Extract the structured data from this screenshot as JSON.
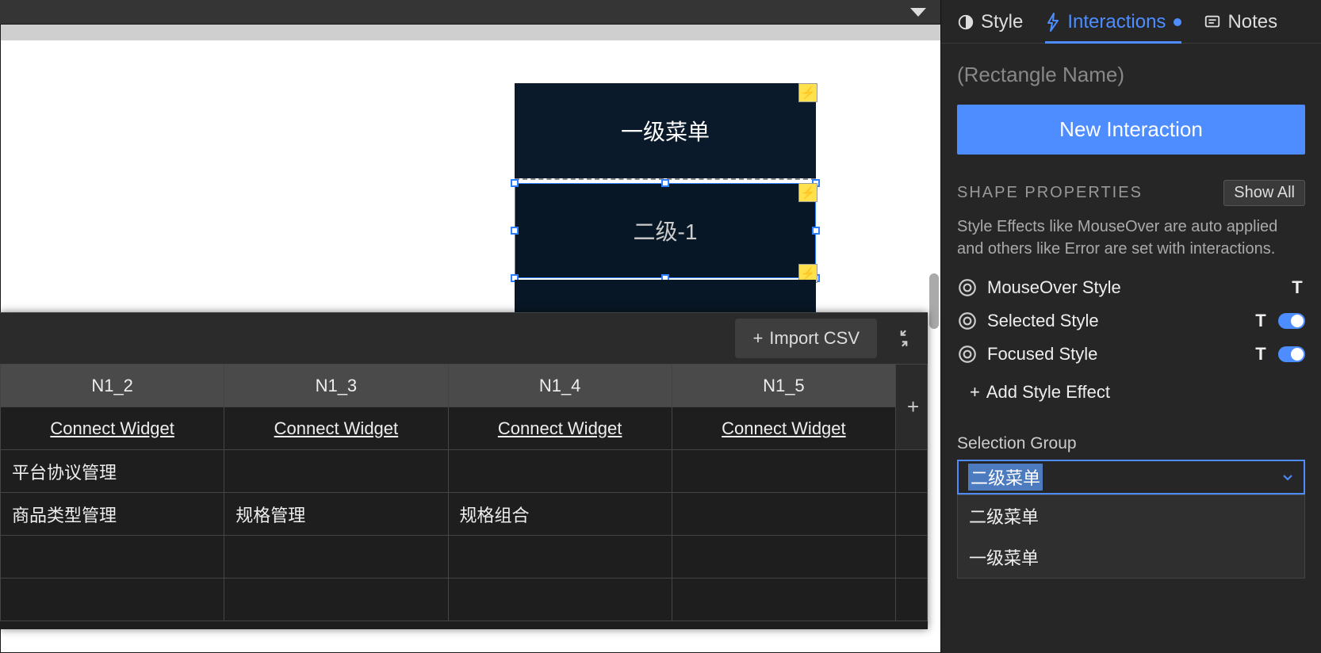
{
  "canvas": {
    "primary_widget_label": "一级菜单",
    "selected_widget_label": "二级-1"
  },
  "data_panel": {
    "import_label": "Import CSV",
    "columns": [
      "N1_2",
      "N1_3",
      "N1_4",
      "N1_5"
    ],
    "connect_label": "Connect Widget",
    "rows": [
      [
        "平台协议管理",
        "",
        "",
        ""
      ],
      [
        "商品类型管理",
        "规格管理",
        "规格组合",
        ""
      ],
      [
        "",
        "",
        "",
        ""
      ],
      [
        "",
        "",
        "",
        ""
      ]
    ]
  },
  "right_panel": {
    "tabs": {
      "style": "Style",
      "interactions": "Interactions",
      "notes": "Notes"
    },
    "name_placeholder": "(Rectangle Name)",
    "new_interaction_label": "New Interaction",
    "shape_properties": {
      "header": "SHAPE PROPERTIES",
      "show_all": "Show All",
      "description": "Style Effects like MouseOver are auto applied and others like Error are set with interactions.",
      "mouseover": "MouseOver Style",
      "selected": "Selected Style",
      "focused": "Focused Style",
      "add_style": "Add Style Effect"
    },
    "selection_group": {
      "label": "Selection Group",
      "value": "二级菜单",
      "options": [
        "二级菜单",
        "一级菜单"
      ]
    }
  }
}
